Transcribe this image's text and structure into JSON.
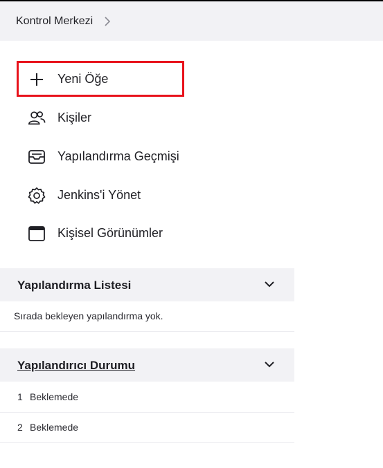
{
  "breadcrumb": {
    "root": "Kontrol Merkezi"
  },
  "tasks": [
    {
      "label": "Yeni Öğe",
      "icon": "plus-icon"
    },
    {
      "label": "Kişiler",
      "icon": "people-icon"
    },
    {
      "label": "Yapılandırma Geçmişi",
      "icon": "inbox-history-icon"
    },
    {
      "label": "Jenkins'i Yönet",
      "icon": "gear-icon"
    },
    {
      "label": "Kişisel Görünümler",
      "icon": "window-icon"
    }
  ],
  "build_queue": {
    "title": "Yapılandırma Listesi",
    "empty_text": "Sırada bekleyen yapılandırma yok."
  },
  "executor_status": {
    "title": "Yapılandırıcı Durumu",
    "executors": [
      {
        "number": "1",
        "status": "Beklemede"
      },
      {
        "number": "2",
        "status": "Beklemede"
      }
    ]
  },
  "colors": {
    "highlight": "#e8121b",
    "panel_bg": "#f2f2f5"
  }
}
